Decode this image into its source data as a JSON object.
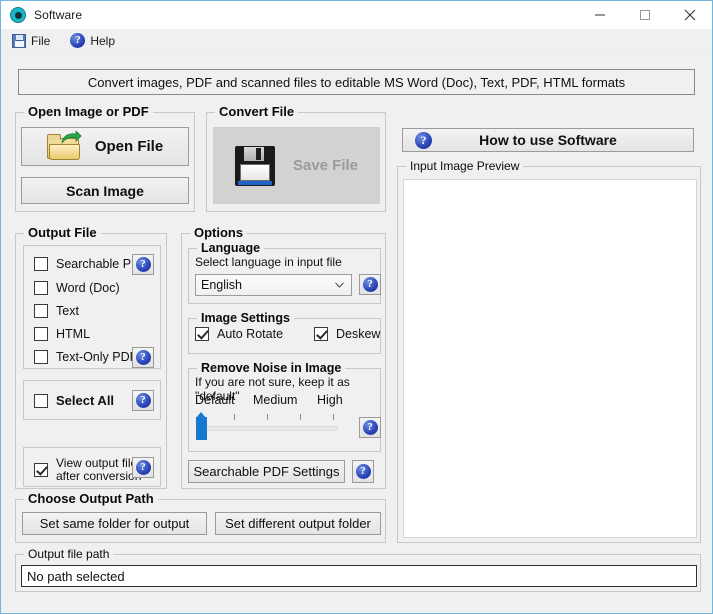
{
  "window": {
    "title": "Software",
    "app_icon": "app-circle-icon",
    "controls": {
      "minimize": "minimize-icon",
      "maximize": "maximize-icon",
      "close": "close-icon"
    }
  },
  "menubar": {
    "items": [
      {
        "label": "File",
        "icon": "floppy-save-icon"
      },
      {
        "label": "Help",
        "icon": "question-circle-icon"
      }
    ]
  },
  "banner": {
    "text": "Convert images, PDF and scanned files to editable MS Word (Doc), Text, PDF, HTML formats"
  },
  "open_group": {
    "title": "Open Image or PDF",
    "open_file_button": "Open File",
    "open_file_icon": "open-folder-icon",
    "scan_image_button": "Scan Image"
  },
  "convert_group": {
    "title": "Convert File",
    "save_file_button": "Save File",
    "save_file_icon": "floppy-disk-icon",
    "save_file_enabled": false
  },
  "output_file_group": {
    "title": "Output File",
    "formats": [
      {
        "label": "Searchable PDF",
        "checked": false,
        "help": true
      },
      {
        "label": "Word (Doc)",
        "checked": false,
        "help": false
      },
      {
        "label": "Text",
        "checked": false,
        "help": false
      },
      {
        "label": "HTML",
        "checked": false,
        "help": false
      },
      {
        "label": "Text-Only PDF",
        "checked": false,
        "help": true
      }
    ],
    "select_all": {
      "label": "Select All",
      "checked": false,
      "help": true
    },
    "view_output": {
      "line1": "View output files",
      "line2": "after conversion",
      "checked": true,
      "help": true
    }
  },
  "options_group": {
    "title": "Options",
    "language": {
      "title": "Language",
      "hint": "Select language in input file",
      "selected": "English",
      "options": [
        "English"
      ],
      "help": true
    },
    "image_settings": {
      "title": "Image Settings",
      "auto_rotate": {
        "label": "Auto Rotate",
        "checked": true
      },
      "deskew": {
        "label": "Deskew",
        "checked": true
      }
    },
    "noise": {
      "title": "Remove Noise in Image",
      "hint": "If you are not sure, keep it as \"default\"",
      "ticks": [
        "Default",
        "Medium",
        "High"
      ],
      "value": 0,
      "help": true
    },
    "searchable_pdf_settings_button": "Searchable PDF Settings",
    "searchable_pdf_settings_help": true
  },
  "output_path_group": {
    "title": "Choose Output Path",
    "same_folder_button": "Set same folder for output",
    "different_folder_button": "Set different output folder"
  },
  "output_file_path": {
    "title": "Output file path",
    "value": "No path selected"
  },
  "right_panel": {
    "how_to_button": "How to use Software",
    "how_to_icon": "question-circle-icon",
    "preview_title": "Input Image Preview"
  },
  "colors": {
    "window_bg": "#f0f0f0",
    "frame": "#6fb7e0",
    "accent_blue": "#1778d0",
    "help_blue": "#2b46b8",
    "disabled_text": "#9b9b9b"
  }
}
